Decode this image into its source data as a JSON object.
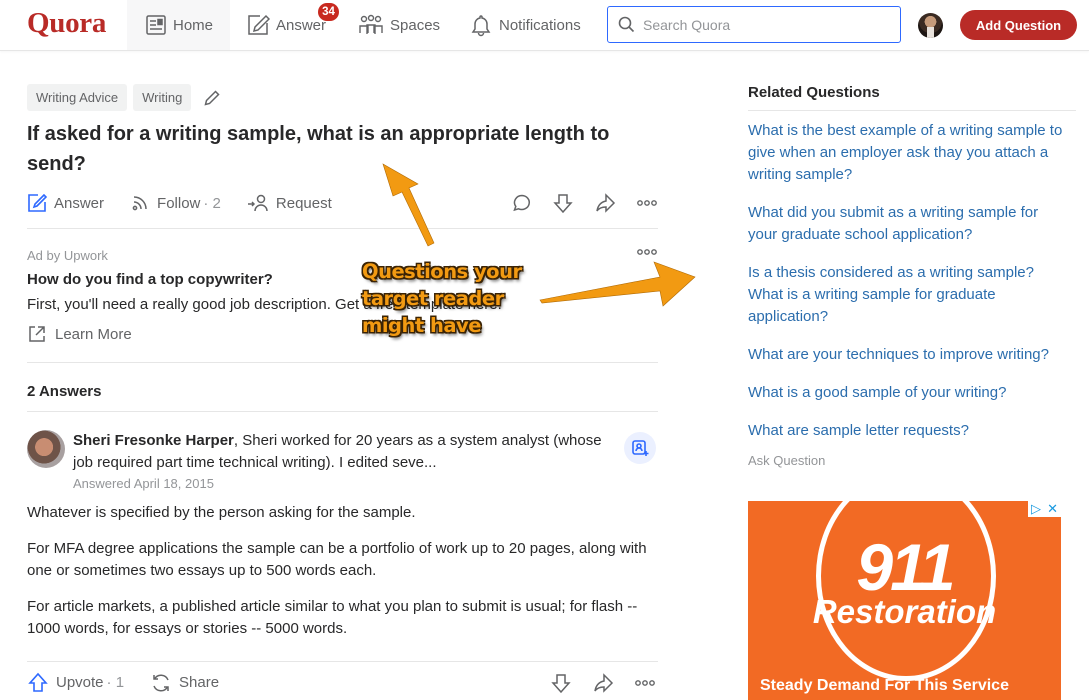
{
  "nav": {
    "logo": "Quora",
    "items": [
      {
        "label": "Home",
        "icon": "home-feed-icon"
      },
      {
        "label": "Answer",
        "icon": "pencil-square-icon",
        "badge": "34"
      },
      {
        "label": "Spaces",
        "icon": "people-group-icon"
      },
      {
        "label": "Notifications",
        "icon": "bell-icon"
      }
    ],
    "search_placeholder": "Search Quora",
    "add_question": "Add Question"
  },
  "question": {
    "topics": [
      "Writing Advice",
      "Writing"
    ],
    "title": "If asked for a writing sample, what is an appropriate length to send?",
    "actions": {
      "answer": "Answer",
      "follow": "Follow",
      "follow_count": "· 2",
      "request": "Request"
    }
  },
  "ad": {
    "label": "Ad by Upwork",
    "title": "How do you find a top copywriter?",
    "text": "First, you'll need a really good job description. Get a free template here.",
    "cta": "Learn More"
  },
  "answers": {
    "heading": "2 Answers",
    "items": [
      {
        "author": "Sheri Fresonke Harper",
        "credential": ", Sheri worked for 20 years as a system analyst (whose job required part time technical writing). I edited seve...",
        "date": "Answered April 18, 2015",
        "paragraphs": [
          "Whatever is specified by the person asking for the sample.",
          "For MFA degree applications the sample can be a portfolio of work up to 20 pages, along with one or sometimes two essays up to 500 words each.",
          "For article markets, a published article similar to what you plan to submit is usual; for flash -- 1000 words, for essays or stories -- 5000 words."
        ],
        "upvote": "Upvote",
        "upvote_count": "· 1",
        "share": "Share"
      }
    ]
  },
  "sidebar": {
    "heading": "Related Questions",
    "questions": [
      "What is the best example of a writing sample to give when an employer ask thay you attach a writing sample?",
      "What did you submit as a writing sample for your graduate school application?",
      "Is a thesis considered as a writing sample? What is a writing sample for graduate application?",
      "What are your techniques to improve writing?",
      "What is a good sample of your writing?",
      "What are sample letter requests?"
    ],
    "ask": "Ask Question"
  },
  "display_ad": {
    "number": "911",
    "brand": "Restoration",
    "tagline": "Steady Demand For This Service",
    "choices_icon": "▷",
    "close_icon": "✕"
  },
  "annotation": {
    "text": "Questions your target reader might have",
    "color": "#f29a12"
  },
  "colors": {
    "brand": "#b92b27",
    "link": "#2b6dad",
    "accent_blue": "#2e69ff",
    "ad_orange": "#f26a24"
  }
}
